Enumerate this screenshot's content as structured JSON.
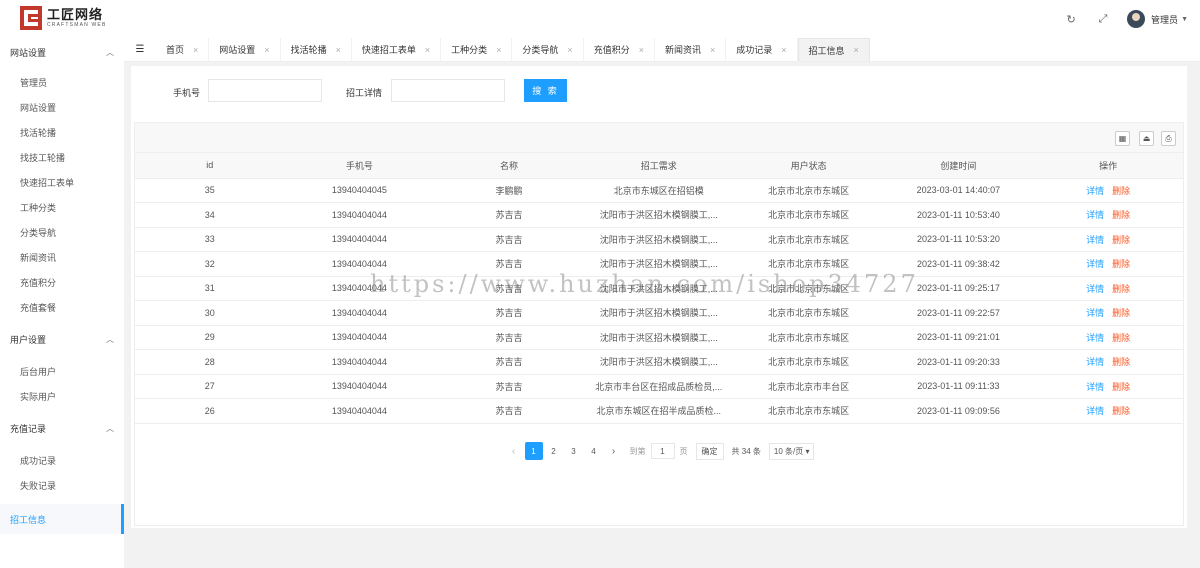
{
  "brand": {
    "title": "工匠网络",
    "subtitle": "CRAFTSMAN WEB"
  },
  "header": {
    "user_name": "管理员"
  },
  "sidebar": {
    "groups": [
      {
        "label": "网站设置",
        "items": [
          "管理员",
          "网站设置",
          "找活轮播",
          "找技工轮播",
          "快速招工表单",
          "工种分类",
          "分类导航",
          "新闻资讯",
          "充值积分",
          "充值套餐"
        ]
      },
      {
        "label": "用户设置",
        "items": [
          "后台用户",
          "实际用户"
        ]
      },
      {
        "label": "充值记录",
        "items": [
          "成功记录",
          "失败记录"
        ]
      }
    ],
    "active_item": "招工信息"
  },
  "tabs": [
    "首页",
    "网站设置",
    "找活轮播",
    "快速招工表单",
    "工种分类",
    "分类导航",
    "充值积分",
    "新闻资讯",
    "成功记录",
    "招工信息"
  ],
  "active_tab": "招工信息",
  "search": {
    "phone_label": "手机号",
    "phone_value": "",
    "detail_label": "招工详情",
    "detail_value": "",
    "button_label": "搜 索"
  },
  "table": {
    "columns": [
      "id",
      "手机号",
      "名称",
      "招工需求",
      "用户状态",
      "创建时间",
      "操作"
    ],
    "rows": [
      {
        "id": "35",
        "phone": "13940404045",
        "name": "李鹏鹏",
        "demand": "北京市东城区在招铝模",
        "status": "北京市北京市东城区",
        "created": "2023-03-01 14:40:07"
      },
      {
        "id": "34",
        "phone": "13940404044",
        "name": "苏吉吉",
        "demand": "沈阳市于洪区招木模钢膜工,...",
        "status": "北京市北京市东城区",
        "created": "2023-01-11 10:53:40"
      },
      {
        "id": "33",
        "phone": "13940404044",
        "name": "苏吉吉",
        "demand": "沈阳市于洪区招木模钢膜工,...",
        "status": "北京市北京市东城区",
        "created": "2023-01-11 10:53:20"
      },
      {
        "id": "32",
        "phone": "13940404044",
        "name": "苏吉吉",
        "demand": "沈阳市于洪区招木模钢膜工,...",
        "status": "北京市北京市东城区",
        "created": "2023-01-11 09:38:42"
      },
      {
        "id": "31",
        "phone": "13940404044",
        "name": "苏吉吉",
        "demand": "沈阳市于洪区招木模钢膜工,...",
        "status": "北京市北京市东城区",
        "created": "2023-01-11 09:25:17"
      },
      {
        "id": "30",
        "phone": "13940404044",
        "name": "苏吉吉",
        "demand": "沈阳市于洪区招木模钢膜工,...",
        "status": "北京市北京市东城区",
        "created": "2023-01-11 09:22:57"
      },
      {
        "id": "29",
        "phone": "13940404044",
        "name": "苏吉吉",
        "demand": "沈阳市于洪区招木模钢膜工,...",
        "status": "北京市北京市东城区",
        "created": "2023-01-11 09:21:01"
      },
      {
        "id": "28",
        "phone": "13940404044",
        "name": "苏吉吉",
        "demand": "沈阳市于洪区招木模钢膜工,...",
        "status": "北京市北京市东城区",
        "created": "2023-01-11 09:20:33"
      },
      {
        "id": "27",
        "phone": "13940404044",
        "name": "苏吉吉",
        "demand": "北京市丰台区在招成品质检员,...",
        "status": "北京市北京市丰台区",
        "created": "2023-01-11 09:11:33"
      },
      {
        "id": "26",
        "phone": "13940404044",
        "name": "苏吉吉",
        "demand": "北京市东城区在招半成品质检...",
        "status": "北京市北京市东城区",
        "created": "2023-01-11 09:09:56"
      }
    ],
    "edit_label": "详情",
    "delete_label": "删除"
  },
  "pager": {
    "pages": [
      "1",
      "2",
      "3",
      "4"
    ],
    "current": "1",
    "goto_label": "到第",
    "goto_value": "1",
    "page_unit": "页",
    "ok_label": "确定",
    "total": "共 34 条",
    "page_size": "10 条/页"
  },
  "watermark": "https://www.huzhan.com/ishop34727",
  "colors": {
    "accent": "#1e9fff",
    "delete": "#ff5722",
    "brand": "#c0392b"
  }
}
